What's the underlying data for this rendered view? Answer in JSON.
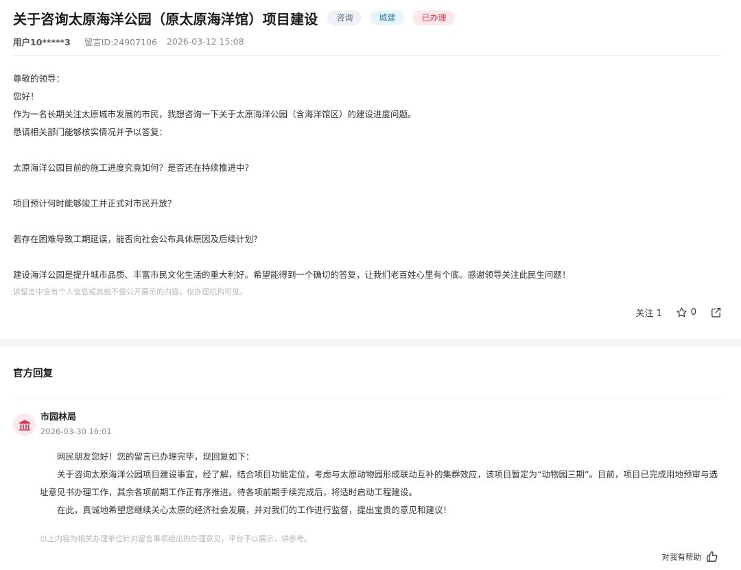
{
  "message": {
    "title": "关于咨询太原海洋公园（原太原海洋馆）项目建设",
    "tags": {
      "type": "咨询",
      "category": "城建",
      "status": "已办理"
    },
    "user": "用户10*****3",
    "message_id": "留言ID:24907106",
    "datetime": "2026-03-12 15:08",
    "body": {
      "greeting": "尊敬的领导：",
      "hello": "您好！",
      "intro": "作为一名长期关注太原城市发展的市民，我想咨询一下关于太原海洋公园（含海洋馆区）的建设进度问题。",
      "request": "恳请相关部门能够核实情况并予以答复：",
      "q1": "太原海洋公园目前的施工进度究竟如何？是否还在持续推进中？",
      "q2": "项目预计何时能够竣工并正式对市民开放？",
      "q3": "若存在困难导致工期延误，能否向社会公布具体原因及后续计划？",
      "closing": "建设海洋公园是提升城市品质、丰富市民文化生活的重大利好。希望能得到一个确切的答复，让我们老百姓心里有个底。感谢领导关注此民生问题！"
    },
    "privacy_note": "该留言中含有个人信息或其他不便公开展示的内容，仅办理机构可见。",
    "actions": {
      "follow_label": "关注 1",
      "star_count": "0"
    }
  },
  "reply": {
    "heading": "官方回复",
    "department": "市园林局",
    "datetime": "2026-03-30 16:01",
    "body": {
      "p1": "网民朋友您好！您的留言已办理完毕，现回复如下：",
      "p2": "关于咨询太原海洋公园项目建设事宜，经了解，结合项目功能定位，考虑与太原动物园形成联动互补的集群效应，该项目暂定为“动物园三期”。目前，项目已完成用地预审与选址意见书办理工作，其余各项前期工作正有序推进。待各项前期手续完成后，将适时启动工程建设。",
      "p3": "在此，真诚地希望您继续关心太原的经济社会发展，并对我们的工作进行监督，提出宝贵的意见和建议！"
    },
    "note": "以上内容为相关办理单位针对留言事项给出的办理意见，平台予以展示，供参考。",
    "helpful_label": "对我有帮助"
  },
  "icons": {
    "star": "star-icon",
    "share": "share-icon",
    "avatar": "government-building-icon",
    "helpful": "thumbs-up-icon"
  },
  "colors": {
    "status_red": "#d8384f",
    "category_blue": "#2f7fb3",
    "avatar_bg": "#fde9ec"
  }
}
